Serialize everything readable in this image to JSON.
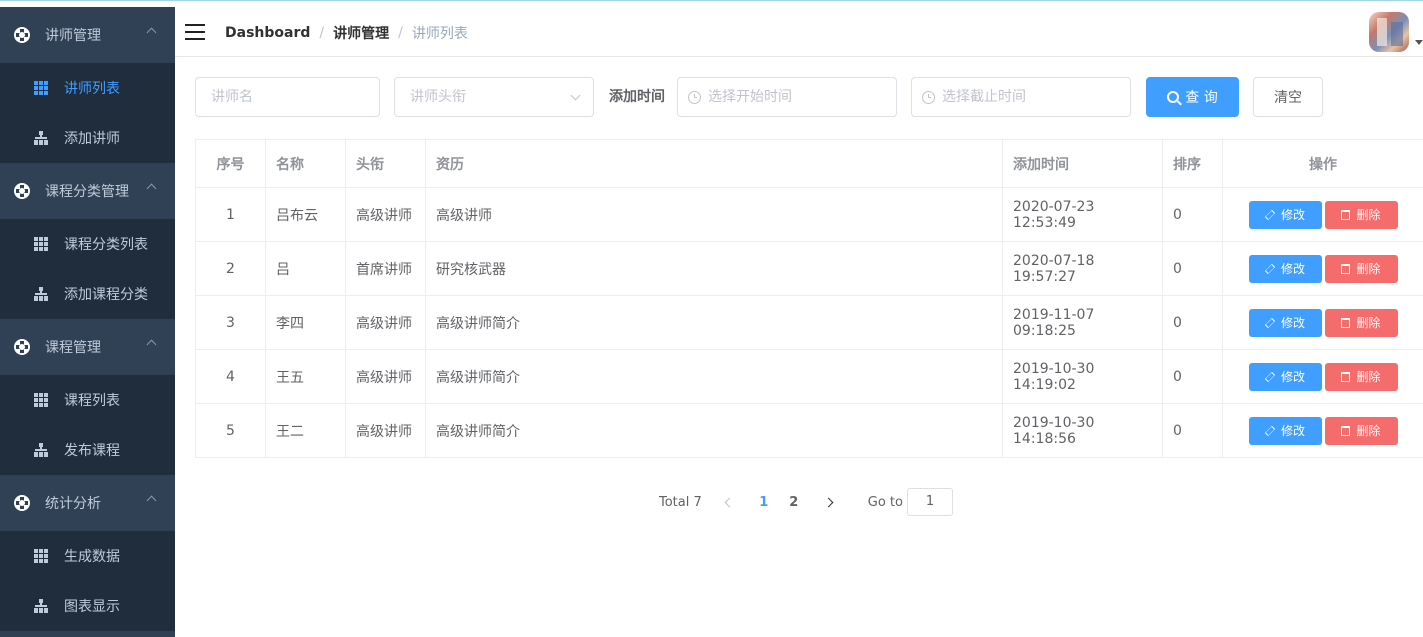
{
  "sidebar": {
    "groups": [
      {
        "title": "讲师管理",
        "items": [
          {
            "label": "讲师列表",
            "icon": "grid-icon",
            "active": true
          },
          {
            "label": "添加讲师",
            "icon": "tree-icon"
          }
        ]
      },
      {
        "title": "课程分类管理",
        "items": [
          {
            "label": "课程分类列表",
            "icon": "grid-icon"
          },
          {
            "label": "添加课程分类",
            "icon": "tree-icon"
          }
        ]
      },
      {
        "title": "课程管理",
        "items": [
          {
            "label": "课程列表",
            "icon": "grid-icon"
          },
          {
            "label": "发布课程",
            "icon": "tree-icon"
          }
        ]
      },
      {
        "title": "统计分析",
        "items": [
          {
            "label": "生成数据",
            "icon": "grid-icon"
          },
          {
            "label": "图表显示",
            "icon": "tree-icon"
          }
        ]
      }
    ]
  },
  "breadcrumb": {
    "home": "Dashboard",
    "section": "讲师管理",
    "current": "讲师列表",
    "separator": "/"
  },
  "filter": {
    "name_placeholder": "讲师名",
    "title_placeholder": "讲师头衔",
    "time_label": "添加时间",
    "start_placeholder": "选择开始时间",
    "end_placeholder": "选择截止时间",
    "search_label": "查 询",
    "clear_label": "清空"
  },
  "table": {
    "headers": [
      "序号",
      "名称",
      "头衔",
      "资历",
      "添加时间",
      "排序",
      "操作"
    ],
    "edit_label": "修改",
    "delete_label": "删除",
    "rows": [
      {
        "index": "1",
        "name": "吕布云",
        "title": "高级讲师",
        "intro": "高级讲师",
        "time": "2020-07-23 12:53:49",
        "sort": "0"
      },
      {
        "index": "2",
        "name": "吕",
        "title": "首席讲师",
        "intro": "研究核武器",
        "time": "2020-07-18 19:57:27",
        "sort": "0"
      },
      {
        "index": "3",
        "name": "李四",
        "title": "高级讲师",
        "intro": "高级讲师简介",
        "time": "2019-11-07 09:18:25",
        "sort": "0"
      },
      {
        "index": "4",
        "name": "王五",
        "title": "高级讲师",
        "intro": "高级讲师简介",
        "time": "2019-10-30 14:19:02",
        "sort": "0"
      },
      {
        "index": "5",
        "name": "王二",
        "title": "高级讲师",
        "intro": "高级讲师简介",
        "time": "2019-10-30 14:18:56",
        "sort": "0"
      }
    ]
  },
  "pagination": {
    "total": "Total 7",
    "pages": [
      "1",
      "2"
    ],
    "current": "1",
    "goto_label": "Go to",
    "goto_value": "1"
  },
  "colors": {
    "primary": "#409eff",
    "danger": "#f56c6c",
    "sidebar": "#304156",
    "submenu": "#1f2d3d"
  }
}
